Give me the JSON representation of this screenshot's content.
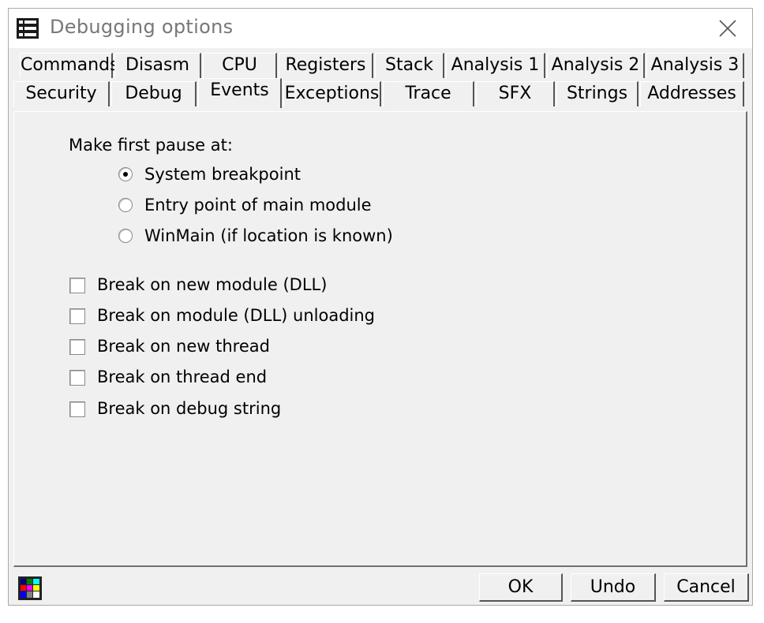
{
  "window": {
    "title": "Debugging options"
  },
  "icons": {
    "app": "list-icon",
    "close": "close-icon",
    "colors": "color-palette-icon"
  },
  "tabs": {
    "row1": [
      "Commands",
      "Disasm",
      "CPU",
      "Registers",
      "Stack",
      "Analysis 1",
      "Analysis 2",
      "Analysis 3"
    ],
    "row2": [
      "Security",
      "Debug",
      "Events",
      "Exceptions",
      "Trace",
      "SFX",
      "Strings",
      "Addresses"
    ],
    "active": "Events"
  },
  "events": {
    "pause_label": "Make first pause at:",
    "pause_options": [
      {
        "label": "System breakpoint",
        "checked": true
      },
      {
        "label": "Entry point of main module",
        "checked": false
      },
      {
        "label": "WinMain (if location is known)",
        "checked": false
      }
    ],
    "checkboxes": [
      {
        "label": "Break on new module (DLL)",
        "checked": false
      },
      {
        "label": "Break on module (DLL) unloading",
        "checked": false
      },
      {
        "label": "Break on new thread",
        "checked": false
      },
      {
        "label": "Break on thread end",
        "checked": false
      },
      {
        "label": "Break on debug string",
        "checked": false
      }
    ]
  },
  "buttons": {
    "ok": "OK",
    "undo": "Undo",
    "cancel": "Cancel"
  },
  "colors": {
    "window_bg": "#f0f0f0",
    "title_text": "#777777"
  }
}
